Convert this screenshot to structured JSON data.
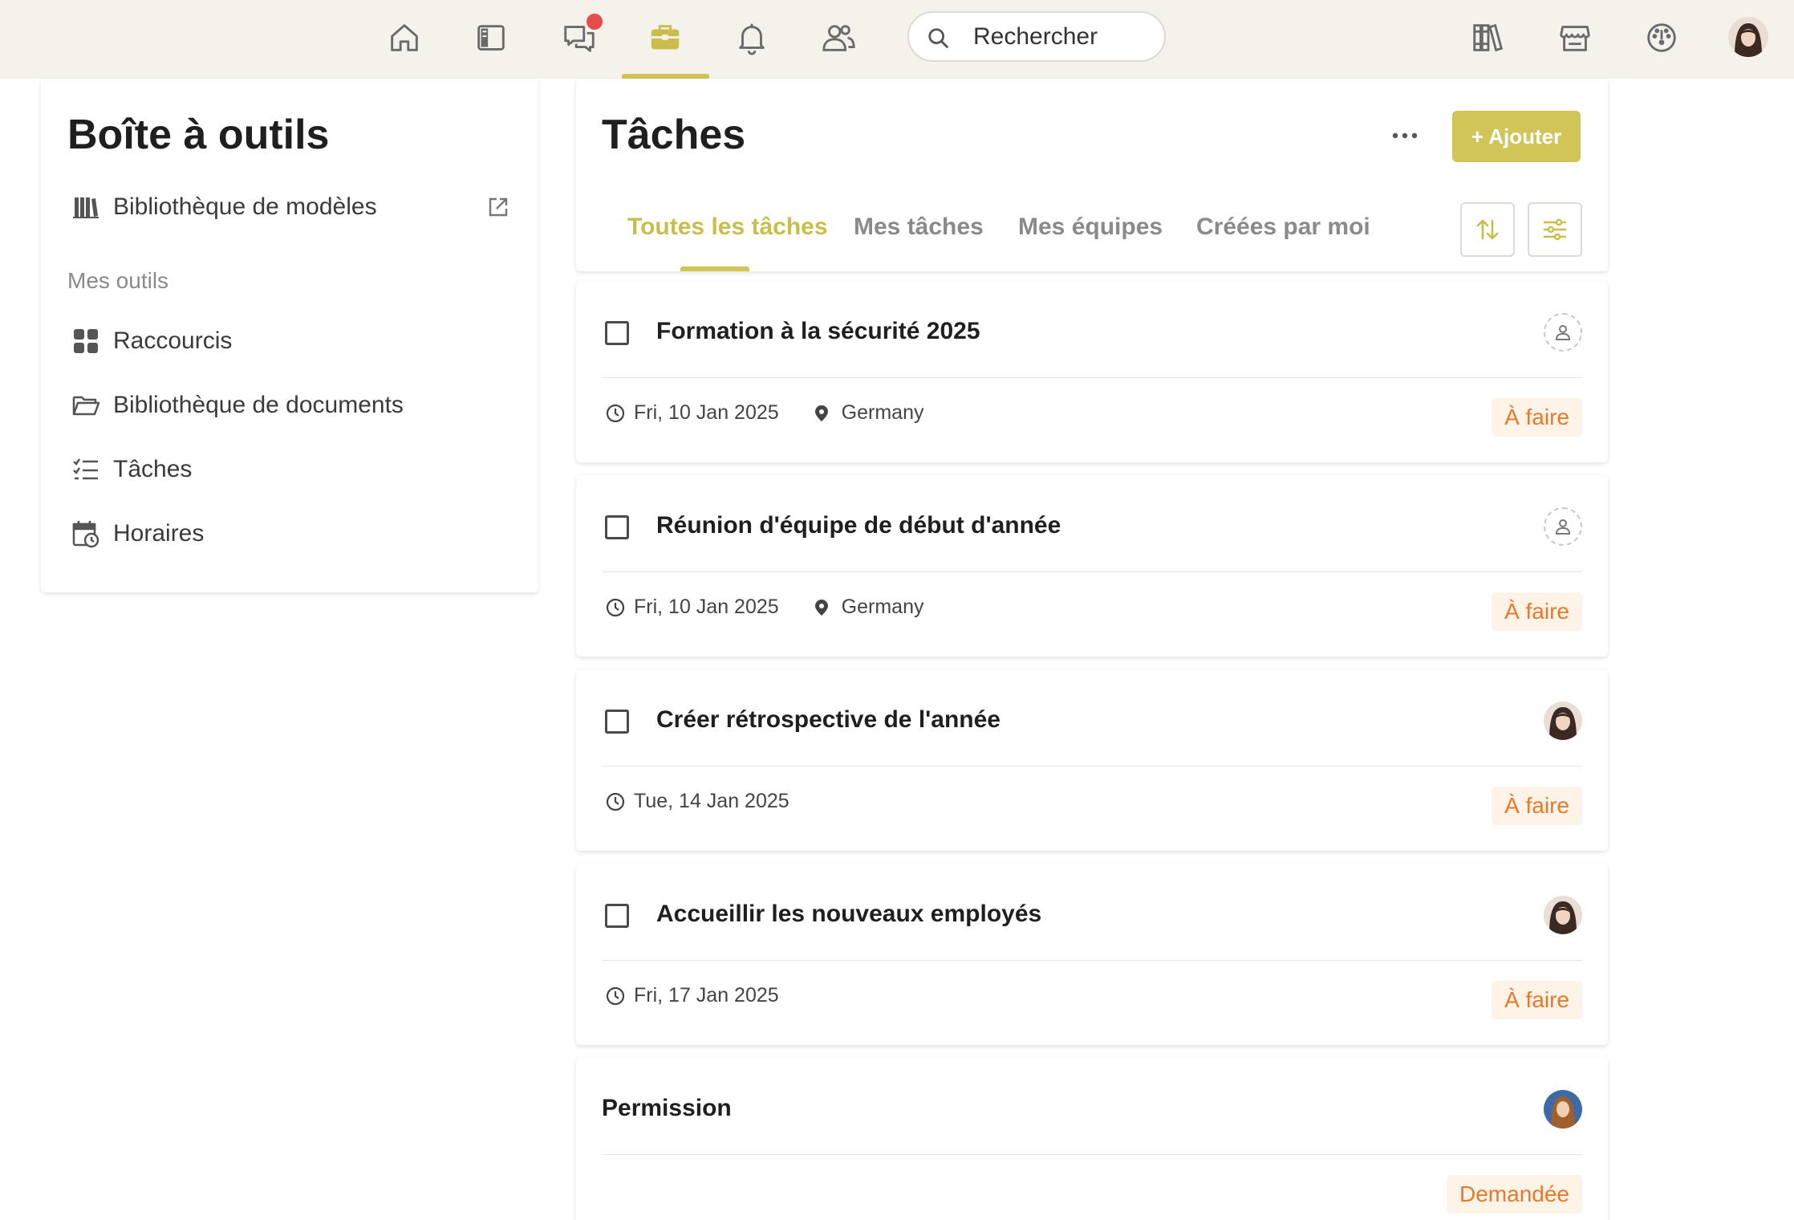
{
  "topbar": {
    "nav": [
      {
        "name": "home-icon"
      },
      {
        "name": "sidebar-icon"
      },
      {
        "name": "chat-icon",
        "badge": true
      },
      {
        "name": "briefcase-icon",
        "active": true
      },
      {
        "name": "bell-icon"
      },
      {
        "name": "users-icon"
      }
    ],
    "search_placeholder": "Rechercher",
    "right_icons": [
      "library-icon",
      "store-icon",
      "gauge-icon"
    ],
    "accent_color": "#d1c557",
    "badge_color": "#e74c4c"
  },
  "sidebar": {
    "title": "Boîte à outils",
    "template_library": "Bibliothèque de modèles",
    "section_label": "Mes outils",
    "items": [
      {
        "label": "Raccourcis",
        "icon": "grid-icon"
      },
      {
        "label": "Bibliothèque de documents",
        "icon": "folder-icon"
      },
      {
        "label": "Tâches",
        "icon": "checklist-icon"
      },
      {
        "label": "Horaires",
        "icon": "calendar-clock-icon"
      }
    ]
  },
  "main": {
    "title": "Tâches",
    "add_button": "+ Ajouter",
    "tabs": [
      {
        "label": "Toutes les tâches",
        "active": true
      },
      {
        "label": "Mes tâches"
      },
      {
        "label": "Mes équipes"
      },
      {
        "label": "Créées par moi"
      }
    ]
  },
  "tasks": [
    {
      "title": "Formation à la sécurité 2025",
      "date": "Fri, 10 Jan 2025",
      "location": "Germany",
      "status": "À faire",
      "assignee": "none"
    },
    {
      "title": "Réunion d'équipe de début d'année",
      "date": "Fri, 10 Jan 2025",
      "location": "Germany",
      "status": "À faire",
      "assignee": "none"
    },
    {
      "title": "Créer rétrospective de l'année",
      "date": "Tue, 14 Jan 2025",
      "status": "À faire",
      "assignee": "avatar"
    },
    {
      "title": "Accueillir les nouveaux employés",
      "date": "Fri, 17 Jan 2025",
      "status": "À faire",
      "assignee": "avatar"
    },
    {
      "title": "Permission",
      "status": "Demandée",
      "assignee": "avatar-blue"
    }
  ],
  "status_colors": {
    "text": "#e8792b",
    "background": "#fdf3e7"
  }
}
